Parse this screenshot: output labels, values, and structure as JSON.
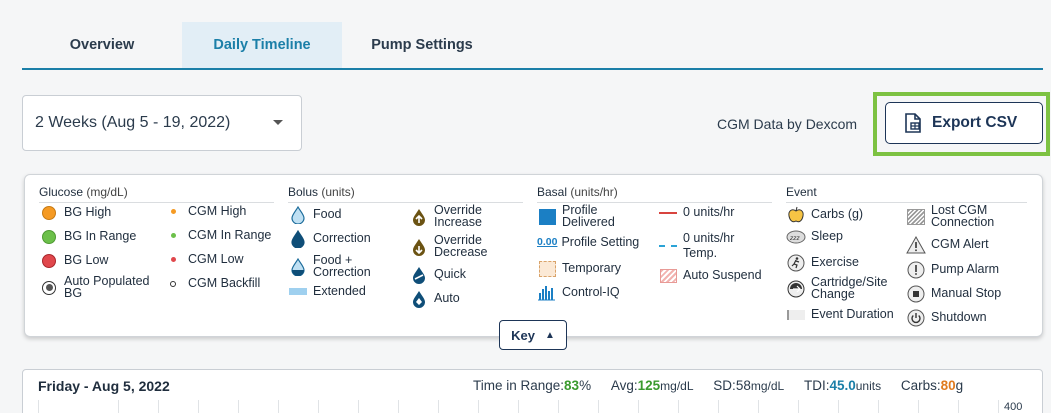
{
  "tabs": [
    {
      "label": "Overview"
    },
    {
      "label": "Daily Timeline"
    },
    {
      "label": "Pump Settings"
    }
  ],
  "date_range": {
    "selected": "2 Weeks (Aug 5 - 19, 2022)"
  },
  "cgm_source": "CGM Data by Dexcom",
  "export_button": "Export CSV",
  "key_panel": {
    "glucose": {
      "title": "Glucose",
      "unit": "(mg/dL)",
      "items": [
        "BG High",
        "BG In Range",
        "BG Low",
        "Auto Populated BG"
      ],
      "cgm_items": [
        "CGM High",
        "CGM In Range",
        "CGM Low",
        "CGM Backfill"
      ],
      "colors": {
        "high": "#f59a23",
        "in_range": "#6cc04a",
        "low": "#e0474c"
      }
    },
    "bolus": {
      "title": "Bolus",
      "unit": "(units)",
      "items": [
        "Food",
        "Correction",
        "Food + Correction",
        "Extended"
      ],
      "override_items": [
        "Override Increase",
        "Override Decrease",
        "Quick",
        "Auto"
      ]
    },
    "basal": {
      "title": "Basal",
      "unit": "(units/hr)",
      "items": [
        "Profile Delivered",
        "Profile Setting",
        "Temporary",
        "Control-IQ"
      ],
      "profile_setting_value": "0.00",
      "right_items": [
        "0 units/hr",
        "0 units/hr Temp.",
        "Auto Suspend"
      ]
    },
    "event": {
      "title": "Event",
      "items": [
        "Carbs (g)",
        "Sleep",
        "Exercise",
        "Cartridge/Site Change",
        "Event Duration"
      ],
      "right_items": [
        "Lost CGM Connection",
        "CGM Alert",
        "Pump Alarm",
        "Manual Stop",
        "Shutdown"
      ]
    },
    "toggle_label": "Key"
  },
  "day": {
    "title": "Friday - Aug 5, 2022",
    "time_in_range_label": "Time in Range:",
    "time_in_range": "83",
    "tir_unit": "%",
    "avg_label": "Avg:",
    "avg": "125",
    "avg_unit": "mg/dL",
    "sd_label": "SD:",
    "sd": "58",
    "sd_unit": "mg/dL",
    "tdi_label": "TDI:",
    "tdi": "45.0",
    "tdi_unit": "units",
    "carbs_label": "Carbs:",
    "carbs": "80",
    "carbs_unit": "g",
    "y_axis_top": "400"
  }
}
